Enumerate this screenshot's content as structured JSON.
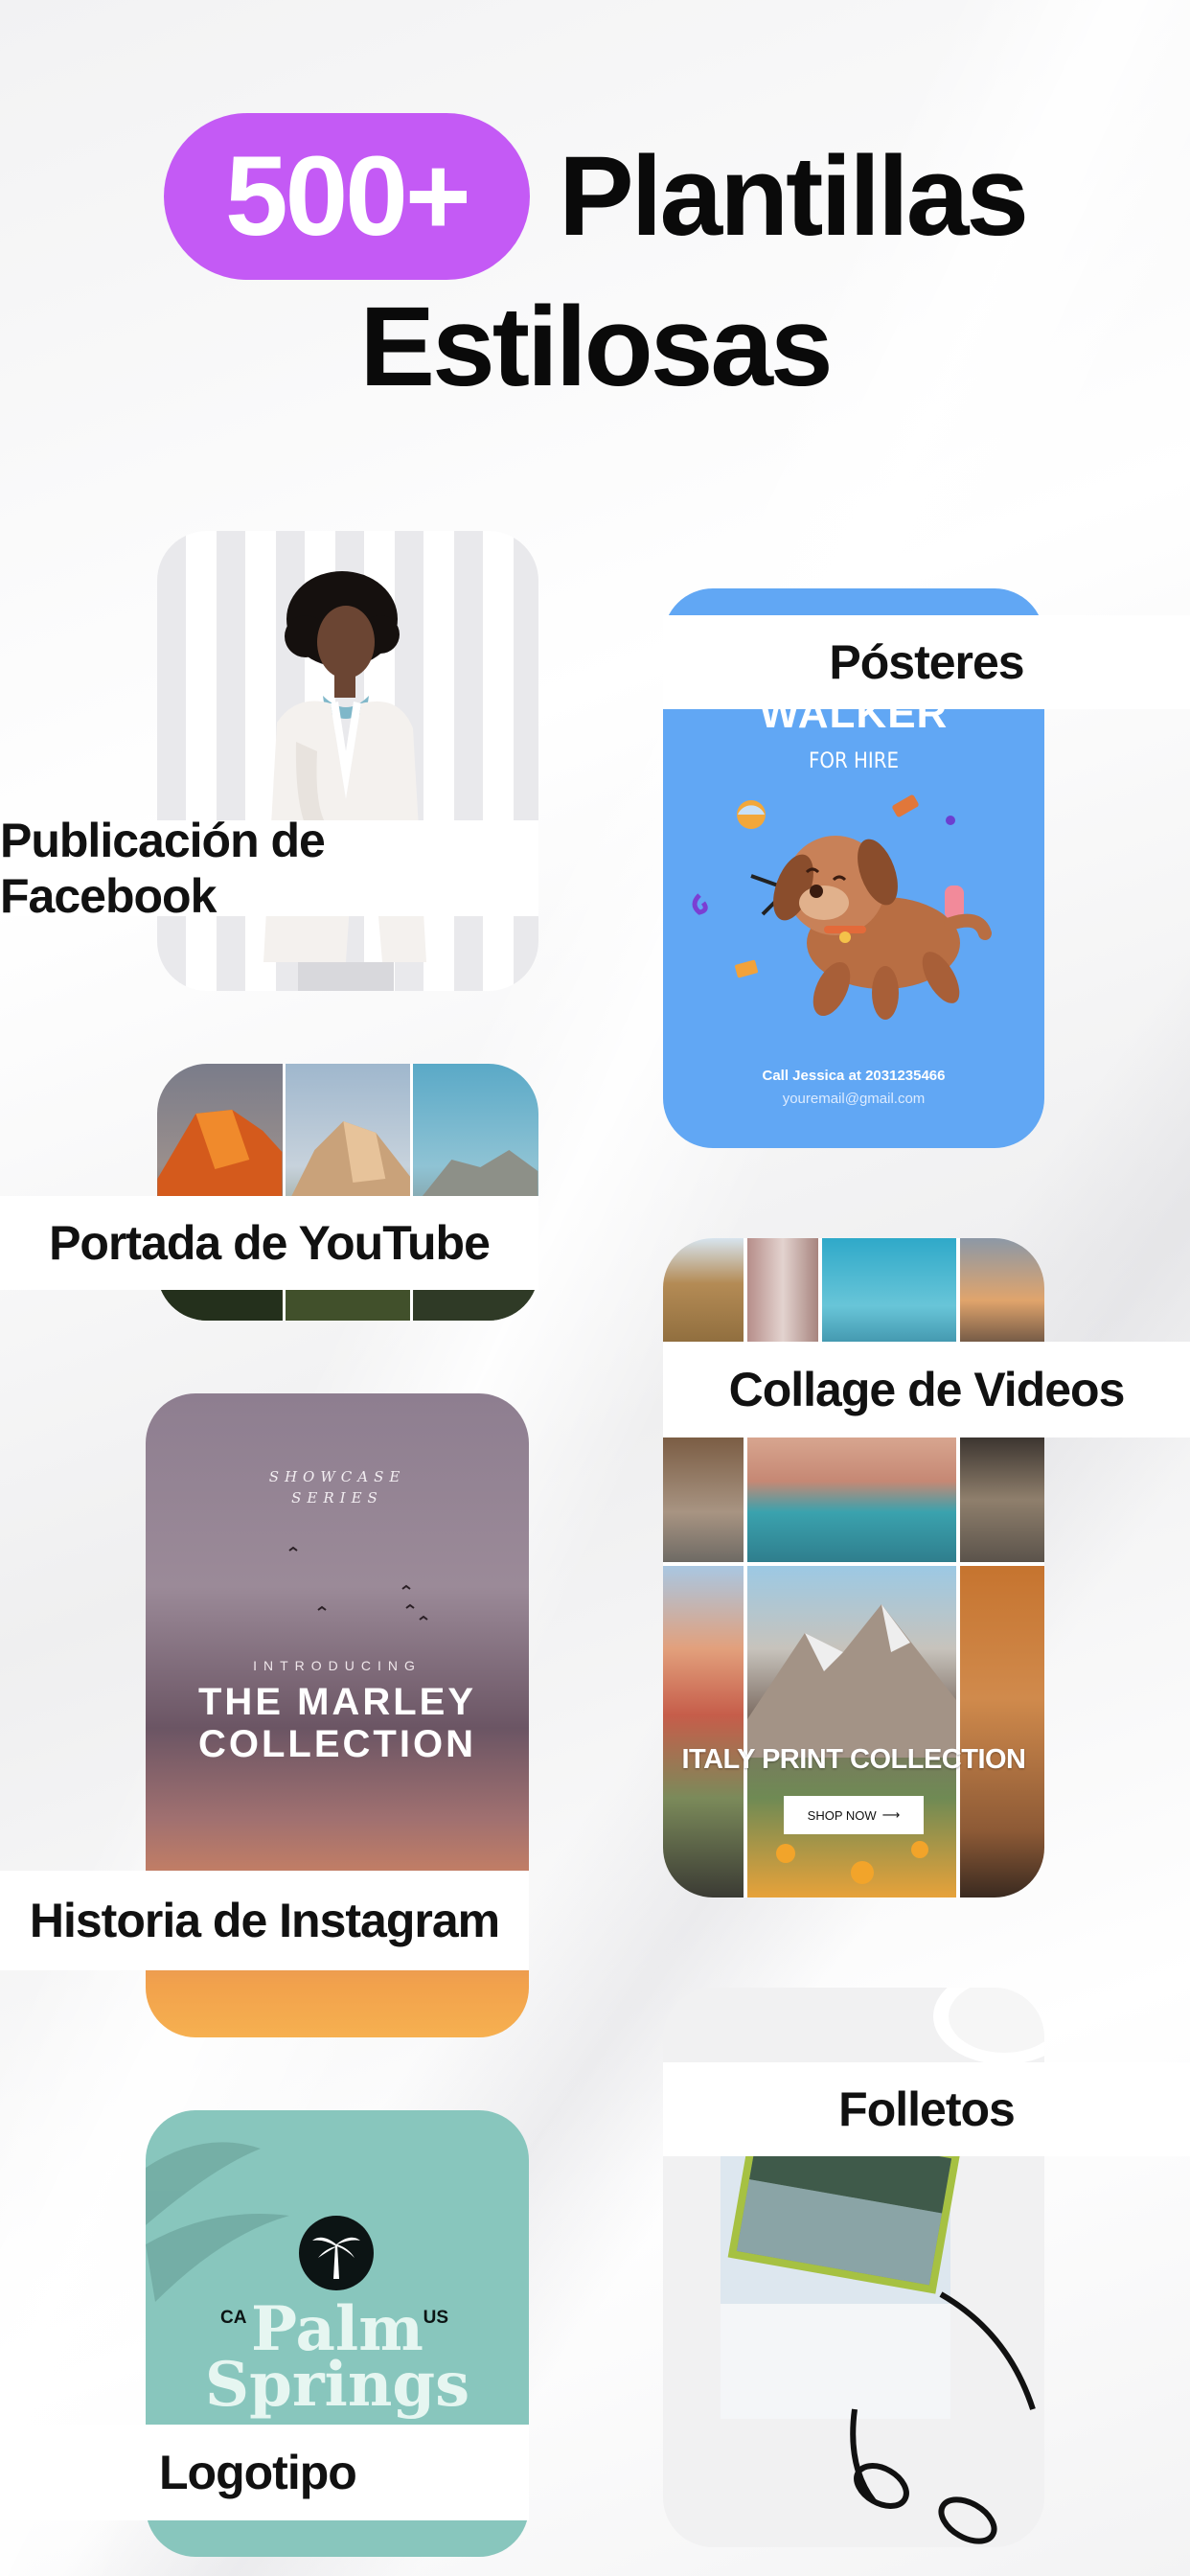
{
  "headline": {
    "badge": "500+",
    "word1": "Plantillas",
    "line2": "Estilosas"
  },
  "templates": {
    "facebook": {
      "label": "Publicación de Facebook"
    },
    "youtube": {
      "label": "Portada de YouTube"
    },
    "instagram": {
      "label": "Historia de Instagram",
      "series_line1": "SHOWCASE",
      "series_line2": "SERIES",
      "intro": "INTRODUCING",
      "title_line1": "THE MARLEY",
      "title_line2": "COLLECTION"
    },
    "logo": {
      "label": "Logotipo",
      "left_tag": "CA",
      "right_tag": "US",
      "name_line1": "Palm",
      "name_line2": "Springs"
    },
    "posters": {
      "label": "Pósteres",
      "title": "WALKER",
      "subtitle": "FOR HIRE",
      "call": "Call Jessica at 2031235466",
      "email": "youremail@gmail.com"
    },
    "collage": {
      "label": "Collage de Videos",
      "headline": "ITALY PRINT COLLECTION",
      "button": "SHOP NOW",
      "button_icon": "arrow-right-icon"
    },
    "flyers": {
      "label": "Folletos"
    }
  },
  "colors": {
    "accent": "#c45af5",
    "poster_bg": "#61a7f4",
    "logo_bg": "#88c6bd"
  }
}
